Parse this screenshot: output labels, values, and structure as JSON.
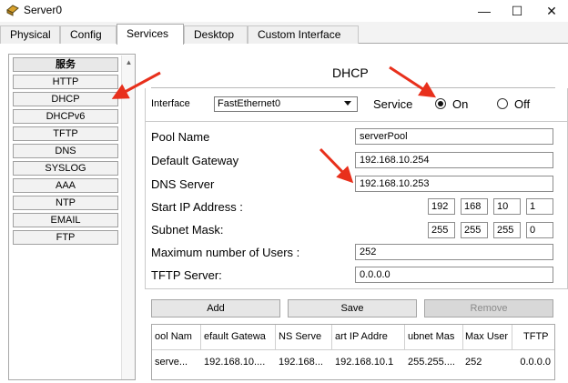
{
  "window": {
    "title": "Server0",
    "controls": {
      "minimize": "—",
      "maximize": "☐",
      "close": "✕"
    }
  },
  "tabs": [
    {
      "label": "Physical"
    },
    {
      "label": "Config"
    },
    {
      "label": "Services",
      "active": true
    },
    {
      "label": "Desktop"
    },
    {
      "label": "Custom Interface"
    }
  ],
  "sidebar": {
    "header": "服务",
    "items": [
      "HTTP",
      "DHCP",
      "DHCPv6",
      "TFTP",
      "DNS",
      "SYSLOG",
      "AAA",
      "NTP",
      "EMAIL",
      "FTP"
    ]
  },
  "dhcp": {
    "title": "DHCP",
    "interface_label": "Interface",
    "interface_value": "FastEthernet0",
    "service_label": "Service",
    "on_label": "On",
    "off_label": "Off",
    "service_state": "On",
    "fields": {
      "pool_name_label": "Pool Name",
      "pool_name": "serverPool",
      "gateway_label": "Default Gateway",
      "gateway": "192.168.10.254",
      "dns_label": "DNS Server",
      "dns": "192.168.10.253",
      "start_ip_label": "Start IP Address :",
      "start_ip": [
        "192",
        "168",
        "10",
        "1"
      ],
      "mask_label": "Subnet Mask:",
      "mask": [
        "255",
        "255",
        "255",
        "0"
      ],
      "max_users_label": "Maximum number of Users :",
      "max_users": "252",
      "tftp_label": "TFTP Server:",
      "tftp": "0.0.0.0"
    },
    "buttons": {
      "add": "Add",
      "save": "Save",
      "remove": "Remove"
    },
    "table": {
      "headers": [
        "ool Nam",
        "efault Gatewa",
        "NS Serve",
        "art IP Addre",
        "ubnet Mas",
        "Max User",
        "TFTP"
      ],
      "row": [
        "serve...",
        "192.168.10....",
        "192.168...",
        "192.168.10.1",
        "255.255....",
        "252",
        "0.0.0.0"
      ]
    }
  },
  "colors": {
    "arrow": "#e8301c",
    "accent": "#ffffff"
  }
}
